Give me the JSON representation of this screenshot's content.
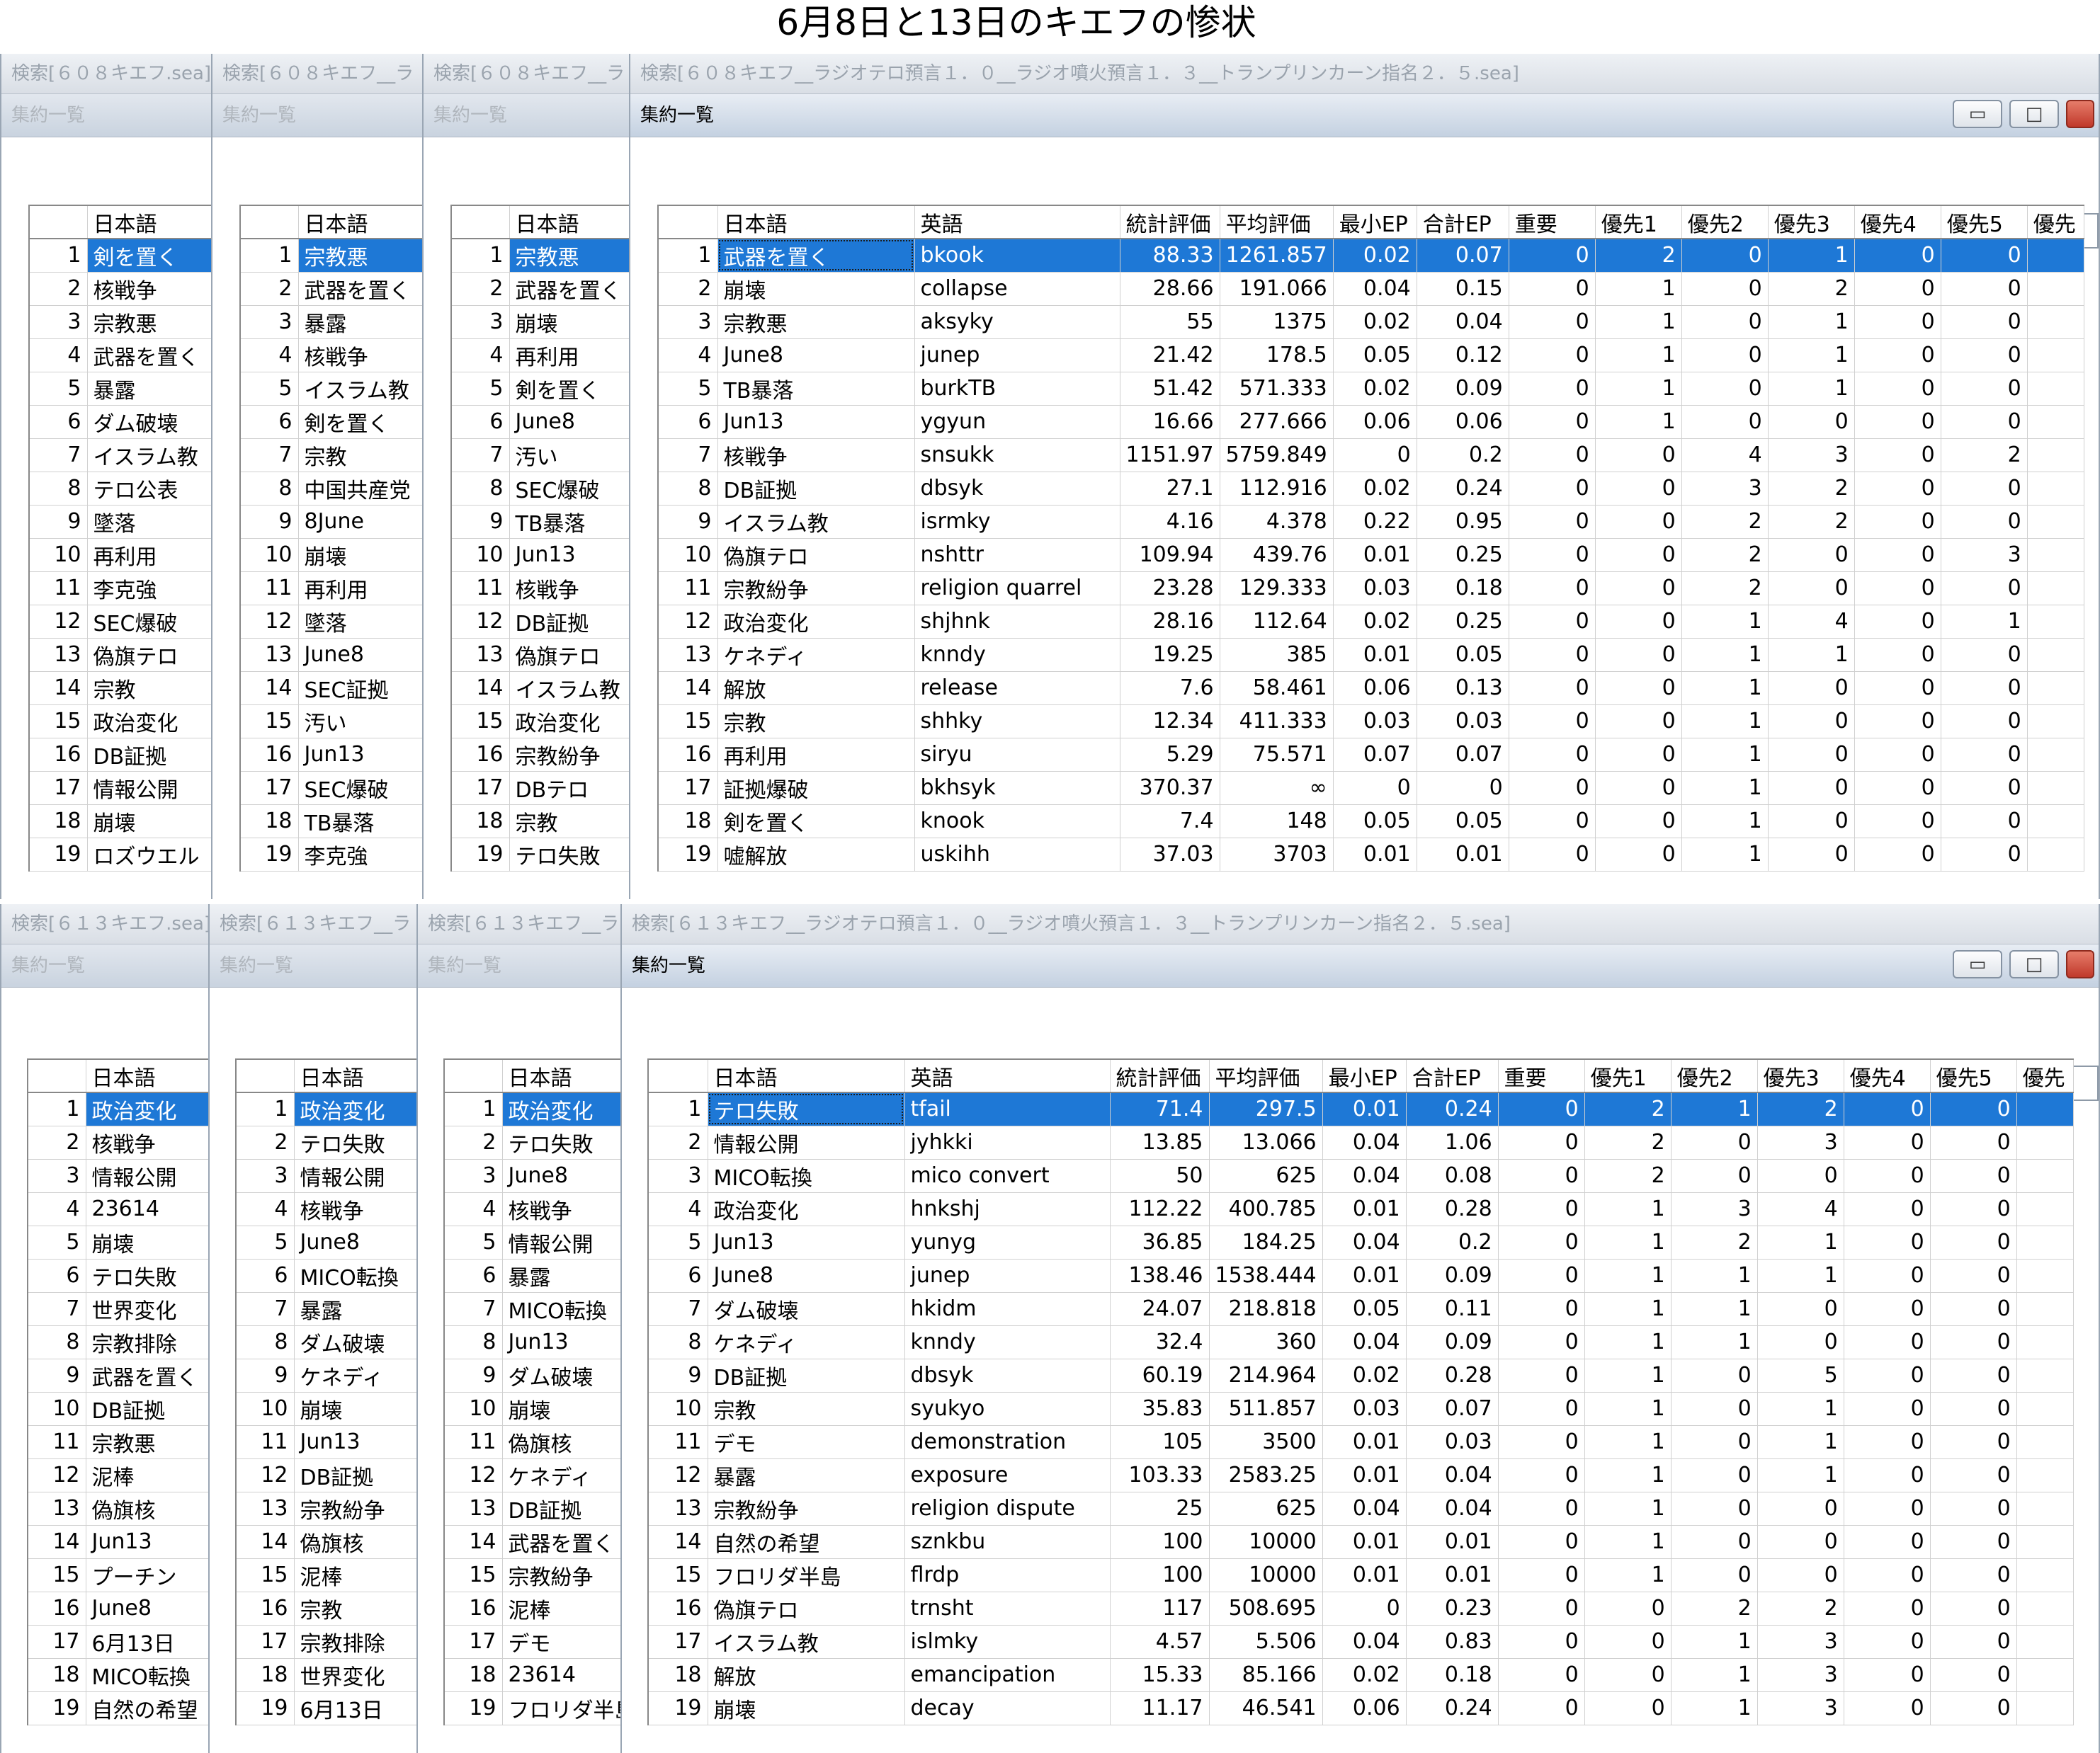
{
  "page_title": "6月8日と13日のキエフの惨状",
  "subwindow_label": "集約一覧",
  "columns": {
    "japanese": "日本語",
    "english": "英語",
    "stat": "統計評価",
    "avg": "平均評価",
    "min_ep": "最小EP",
    "sum_ep": "合計EP",
    "important": "重要",
    "p1": "優先1",
    "p2": "優先2",
    "p3": "優先3",
    "p4": "優先4",
    "p5": "優先5",
    "p6": "優先"
  },
  "top": {
    "titles": [
      "検索[６０８キエフ.sea]",
      "検索[６０８キエフ__ラ",
      "検索[６０８キエフ__ラ",
      "検索[６０８キエフ__ラジオテロ預言１．０__ラジオ噴火預言１．３__トランプリンカーン指名２．５.sea]"
    ],
    "list1": [
      "剣を置く",
      "核戦争",
      "宗教悪",
      "武器を置く",
      "暴露",
      "ダム破壊",
      "イスラム教",
      "テロ公表",
      "墜落",
      "再利用",
      "李克強",
      "SEC爆破",
      "偽旗テロ",
      "宗教",
      "政治変化",
      "DB証拠",
      "情報公開",
      "崩壊",
      "ロズウエル"
    ],
    "list2": [
      "宗教悪",
      "武器を置く",
      "暴露",
      "核戦争",
      "イスラム教",
      "剣を置く",
      "宗教",
      "中国共産党",
      "8June",
      "崩壊",
      "再利用",
      "墜落",
      "June8",
      "SEC証拠",
      "汚い",
      "Jun13",
      "SEC爆破",
      "TB暴落",
      "李克強"
    ],
    "list3": [
      "宗教悪",
      "武器を置く",
      "崩壊",
      "再利用",
      "剣を置く",
      "June8",
      "汚い",
      "SEC爆破",
      "TB暴落",
      "Jun13",
      "核戦争",
      "DB証拠",
      "偽旗テロ",
      "イスラム教",
      "政治変化",
      "宗教紛争",
      "DBテロ",
      "宗教",
      "テロ失敗"
    ],
    "rows": [
      [
        "武器を置く",
        "bkook",
        "88.33",
        "1261.857",
        "0.02",
        "0.07",
        "0",
        "2",
        "0",
        "1",
        "0",
        "0"
      ],
      [
        "崩壊",
        "collapse",
        "28.66",
        "191.066",
        "0.04",
        "0.15",
        "0",
        "1",
        "0",
        "2",
        "0",
        "0"
      ],
      [
        "宗教悪",
        "aksyky",
        "55",
        "1375",
        "0.02",
        "0.04",
        "0",
        "1",
        "0",
        "1",
        "0",
        "0"
      ],
      [
        "June8",
        "junep",
        "21.42",
        "178.5",
        "0.05",
        "0.12",
        "0",
        "1",
        "0",
        "1",
        "0",
        "0"
      ],
      [
        "TB暴落",
        "burkTB",
        "51.42",
        "571.333",
        "0.02",
        "0.09",
        "0",
        "1",
        "0",
        "1",
        "0",
        "0"
      ],
      [
        "Jun13",
        "ygyun",
        "16.66",
        "277.666",
        "0.06",
        "0.06",
        "0",
        "1",
        "0",
        "0",
        "0",
        "0"
      ],
      [
        "核戦争",
        "snsukk",
        "1151.97",
        "5759.849",
        "0",
        "0.2",
        "0",
        "0",
        "4",
        "3",
        "0",
        "2"
      ],
      [
        "DB証拠",
        "dbsyk",
        "27.1",
        "112.916",
        "0.02",
        "0.24",
        "0",
        "0",
        "3",
        "2",
        "0",
        "0"
      ],
      [
        "イスラム教",
        "isrmky",
        "4.16",
        "4.378",
        "0.22",
        "0.95",
        "0",
        "0",
        "2",
        "2",
        "0",
        "0"
      ],
      [
        "偽旗テロ",
        "nshttr",
        "109.94",
        "439.76",
        "0.01",
        "0.25",
        "0",
        "0",
        "2",
        "0",
        "0",
        "3"
      ],
      [
        "宗教紛争",
        "religion quarrel",
        "23.28",
        "129.333",
        "0.03",
        "0.18",
        "0",
        "0",
        "2",
        "0",
        "0",
        "0"
      ],
      [
        "政治変化",
        "shjhnk",
        "28.16",
        "112.64",
        "0.02",
        "0.25",
        "0",
        "0",
        "1",
        "4",
        "0",
        "1"
      ],
      [
        "ケネディ",
        "knndy",
        "19.25",
        "385",
        "0.01",
        "0.05",
        "0",
        "0",
        "1",
        "1",
        "0",
        "0"
      ],
      [
        "解放",
        "release",
        "7.6",
        "58.461",
        "0.06",
        "0.13",
        "0",
        "0",
        "1",
        "0",
        "0",
        "0"
      ],
      [
        "宗教",
        "shhky",
        "12.34",
        "411.333",
        "0.03",
        "0.03",
        "0",
        "0",
        "1",
        "0",
        "0",
        "0"
      ],
      [
        "再利用",
        "siryu",
        "5.29",
        "75.571",
        "0.07",
        "0.07",
        "0",
        "0",
        "1",
        "0",
        "0",
        "0"
      ],
      [
        "証拠爆破",
        "bkhsyk",
        "370.37",
        "∞",
        "0",
        "0",
        "0",
        "0",
        "1",
        "0",
        "0",
        "0"
      ],
      [
        "剣を置く",
        "knook",
        "7.4",
        "148",
        "0.05",
        "0.05",
        "0",
        "0",
        "1",
        "0",
        "0",
        "0"
      ],
      [
        "嘘解放",
        "uskihh",
        "37.03",
        "3703",
        "0.01",
        "0.01",
        "0",
        "0",
        "1",
        "0",
        "0",
        "0"
      ]
    ]
  },
  "bottom": {
    "titles": [
      "検索[６１３キエフ.sea]",
      "検索[６１３キエフ__ラ",
      "検索[６１３キエフ__ラ",
      "検索[６１３キエフ__ラジオテロ預言１．０__ラジオ噴火預言１．３__トランプリンカーン指名２．５.sea]"
    ],
    "list1": [
      "政治変化",
      "核戦争",
      "情報公開",
      "23614",
      "崩壊",
      "テロ失敗",
      "世界変化",
      "宗教排除",
      "武器を置く",
      "DB証拠",
      "宗教悪",
      "泥棒",
      "偽旗核",
      "Jun13",
      "プーチン",
      "June8",
      "6月13日",
      "MICO転換",
      "自然の希望"
    ],
    "list2": [
      "政治変化",
      "テロ失敗",
      "情報公開",
      "核戦争",
      "June8",
      "MICO転換",
      "暴露",
      "ダム破壊",
      "ケネディ",
      "崩壊",
      "Jun13",
      "DB証拠",
      "宗教紛争",
      "偽旗核",
      "泥棒",
      "宗教",
      "宗教排除",
      "世界変化",
      "6月13日"
    ],
    "list3": [
      "政治変化",
      "テロ失敗",
      "June8",
      "核戦争",
      "情報公開",
      "暴露",
      "MICO転換",
      "Jun13",
      "ダム破壊",
      "崩壊",
      "偽旗核",
      "ケネディ",
      "DB証拠",
      "武器を置く",
      "宗教紛争",
      "泥棒",
      "デモ",
      "23614",
      "フロリダ半島"
    ],
    "rows": [
      [
        "テロ失敗",
        "tfail",
        "71.4",
        "297.5",
        "0.01",
        "0.24",
        "0",
        "2",
        "1",
        "2",
        "0",
        "0"
      ],
      [
        "情報公開",
        "jyhkki",
        "13.85",
        "13.066",
        "0.04",
        "1.06",
        "0",
        "2",
        "0",
        "3",
        "0",
        "0"
      ],
      [
        "MICO転換",
        "mico convert",
        "50",
        "625",
        "0.04",
        "0.08",
        "0",
        "2",
        "0",
        "0",
        "0",
        "0"
      ],
      [
        "政治変化",
        "hnkshj",
        "112.22",
        "400.785",
        "0.01",
        "0.28",
        "0",
        "1",
        "3",
        "4",
        "0",
        "0"
      ],
      [
        "Jun13",
        "yunyg",
        "36.85",
        "184.25",
        "0.04",
        "0.2",
        "0",
        "1",
        "2",
        "1",
        "0",
        "0"
      ],
      [
        "June8",
        "junep",
        "138.46",
        "1538.444",
        "0.01",
        "0.09",
        "0",
        "1",
        "1",
        "1",
        "0",
        "0"
      ],
      [
        "ダム破壊",
        "hkidm",
        "24.07",
        "218.818",
        "0.05",
        "0.11",
        "0",
        "1",
        "1",
        "0",
        "0",
        "0"
      ],
      [
        "ケネディ",
        "knndy",
        "32.4",
        "360",
        "0.04",
        "0.09",
        "0",
        "1",
        "1",
        "0",
        "0",
        "0"
      ],
      [
        "DB証拠",
        "dbsyk",
        "60.19",
        "214.964",
        "0.02",
        "0.28",
        "0",
        "1",
        "0",
        "5",
        "0",
        "0"
      ],
      [
        "宗教",
        "syukyo",
        "35.83",
        "511.857",
        "0.03",
        "0.07",
        "0",
        "1",
        "0",
        "1",
        "0",
        "0"
      ],
      [
        "デモ",
        "demonstration",
        "105",
        "3500",
        "0.01",
        "0.03",
        "0",
        "1",
        "0",
        "1",
        "0",
        "0"
      ],
      [
        "暴露",
        "exposure",
        "103.33",
        "2583.25",
        "0.01",
        "0.04",
        "0",
        "1",
        "0",
        "1",
        "0",
        "0"
      ],
      [
        "宗教紛争",
        "religion dispute",
        "25",
        "625",
        "0.04",
        "0.04",
        "0",
        "1",
        "0",
        "0",
        "0",
        "0"
      ],
      [
        "自然の希望",
        "sznkbu",
        "100",
        "10000",
        "0.01",
        "0.01",
        "0",
        "1",
        "0",
        "0",
        "0",
        "0"
      ],
      [
        "フロリダ半島",
        "flrdp",
        "100",
        "10000",
        "0.01",
        "0.01",
        "0",
        "1",
        "0",
        "0",
        "0",
        "0"
      ],
      [
        "偽旗テロ",
        "trnsht",
        "117",
        "508.695",
        "0",
        "0.23",
        "0",
        "0",
        "2",
        "2",
        "0",
        "0"
      ],
      [
        "イスラム教",
        "islmky",
        "4.57",
        "5.506",
        "0.04",
        "0.83",
        "0",
        "0",
        "1",
        "3",
        "0",
        "0"
      ],
      [
        "解放",
        "emancipation",
        "15.33",
        "85.166",
        "0.02",
        "0.18",
        "0",
        "0",
        "1",
        "3",
        "0",
        "0"
      ],
      [
        "崩壊",
        "decay",
        "11.17",
        "46.541",
        "0.06",
        "0.24",
        "0",
        "0",
        "1",
        "3",
        "0",
        "0"
      ]
    ]
  }
}
